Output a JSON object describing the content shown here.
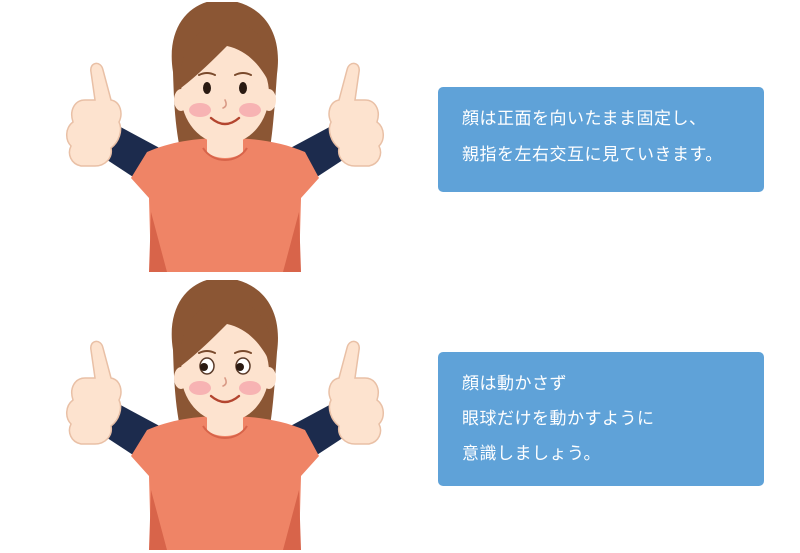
{
  "colors": {
    "background": "#ffffff",
    "box_fill": "#5fa2d8",
    "box_text": "#ffffff",
    "shirt": "#ef8466",
    "shirt_shadow": "#d8644a",
    "sleeve": "#1c2b4d",
    "skin": "#fde3cf",
    "hair": "#8b5634",
    "cheek": "#f7b3b3"
  },
  "figures": {
    "top": {
      "illustration": "woman-thumbs-up-looking-forward-icon"
    },
    "bottom": {
      "illustration": "woman-thumbs-up-eyes-moving-icon"
    }
  },
  "notes": {
    "top": {
      "lines": [
        "顔は正面を向いたまま固定し、",
        "親指を左右交互に見ていきます。"
      ]
    },
    "bottom": {
      "lines": [
        "顔は動かさず",
        "眼球だけを動かすように",
        "意識しましょう。"
      ]
    }
  }
}
